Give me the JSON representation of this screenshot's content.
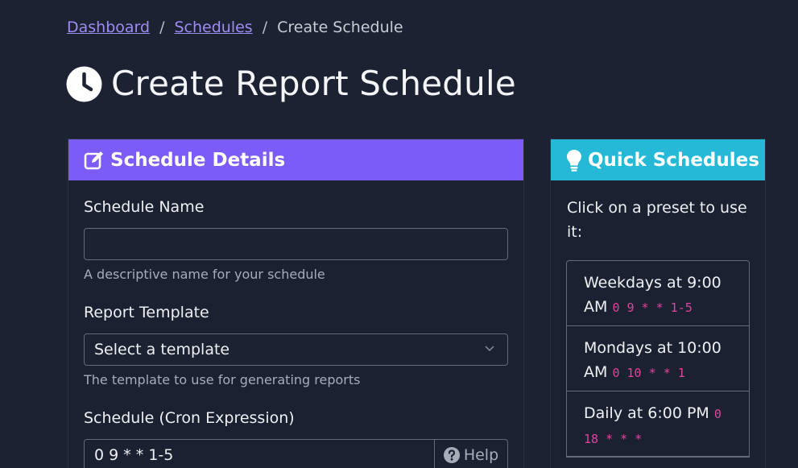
{
  "breadcrumb": {
    "dashboard": "Dashboard",
    "schedules": "Schedules",
    "current": "Create Schedule",
    "separator": "/"
  },
  "page_title": "Create Report Schedule",
  "details_card": {
    "title": "Schedule Details",
    "name_label": "Schedule Name",
    "name_value": "",
    "name_help": "A descriptive name for your schedule",
    "template_label": "Report Template",
    "template_selected": "Select a template",
    "template_help": "The template to use for generating reports",
    "cron_label": "Schedule (Cron Expression)",
    "cron_value": "0 9 * * 1-5",
    "help_button": "Help"
  },
  "quick_card": {
    "title": "Quick Schedules",
    "intro": "Click on a preset to use it:",
    "presets": [
      {
        "label": "Weekdays at 9:00 AM",
        "cron": "0 9 * * 1-5"
      },
      {
        "label": "Mondays at 10:00 AM",
        "cron": "0 10 * * 1"
      },
      {
        "label": "Daily at 6:00 PM",
        "cron": "0 18 * * *"
      }
    ]
  },
  "colors": {
    "background": "#1c2232",
    "details_header": "#7c5cf7",
    "quick_header": "#25b9d7",
    "link": "#9d8cf4",
    "code": "#e0439a"
  }
}
